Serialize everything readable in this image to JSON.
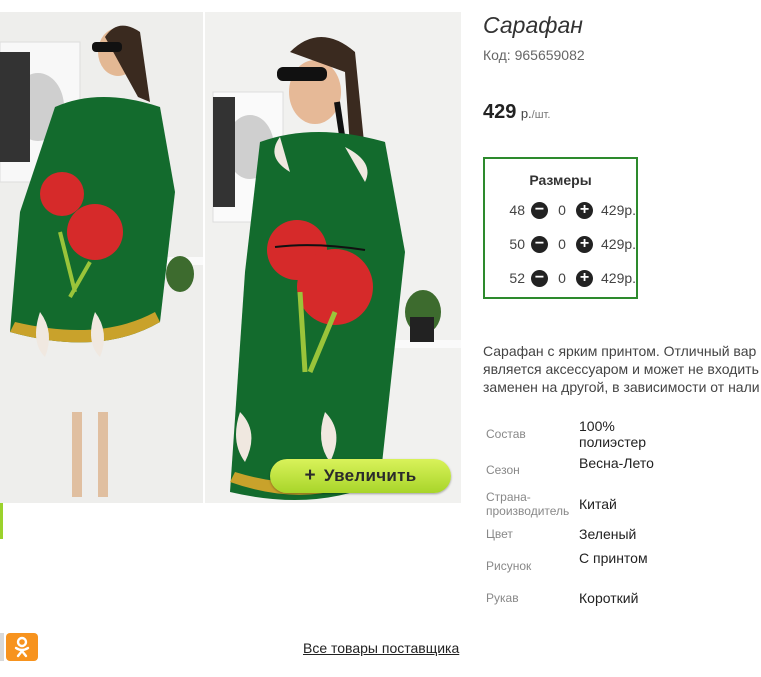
{
  "product": {
    "title": "Сарафан",
    "code": "Код: 965659082",
    "price": "429",
    "price_unit": "р.",
    "price_per": "/шт."
  },
  "gallery": {
    "zoom_label": "Увеличить"
  },
  "sizes": {
    "header": "Размеры",
    "rows": [
      {
        "size": "48",
        "qty": "0",
        "price": "429р."
      },
      {
        "size": "50",
        "qty": "0",
        "price": "429р."
      },
      {
        "size": "52",
        "qty": "0",
        "price": "429р."
      }
    ]
  },
  "description": [
    "Сарафан с ярким принтом. Отличный вар",
    "является аксессуаром и может не входить",
    "заменен на другой, в зависимости от нали"
  ],
  "specs": [
    {
      "key": "Состав",
      "value": "100% полиэстер"
    },
    {
      "key": "Сезон",
      "value": "Весна-Лето"
    },
    {
      "key": "Страна-производитель",
      "value": "Китай"
    },
    {
      "key": "Цвет",
      "value": "Зеленый"
    },
    {
      "key": "Рисунок",
      "value": "С принтом"
    },
    {
      "key": "Рукав",
      "value": "Короткий"
    }
  ],
  "footer": {
    "supplier_link": "Все товары поставщика"
  },
  "colors": {
    "accent_green": "#2d8a2d",
    "zoom_button": "#b9e03a",
    "ok_orange": "#f7931e"
  },
  "icons": [
    "minus-icon",
    "plus-icon",
    "odnoklassniki-icon"
  ]
}
